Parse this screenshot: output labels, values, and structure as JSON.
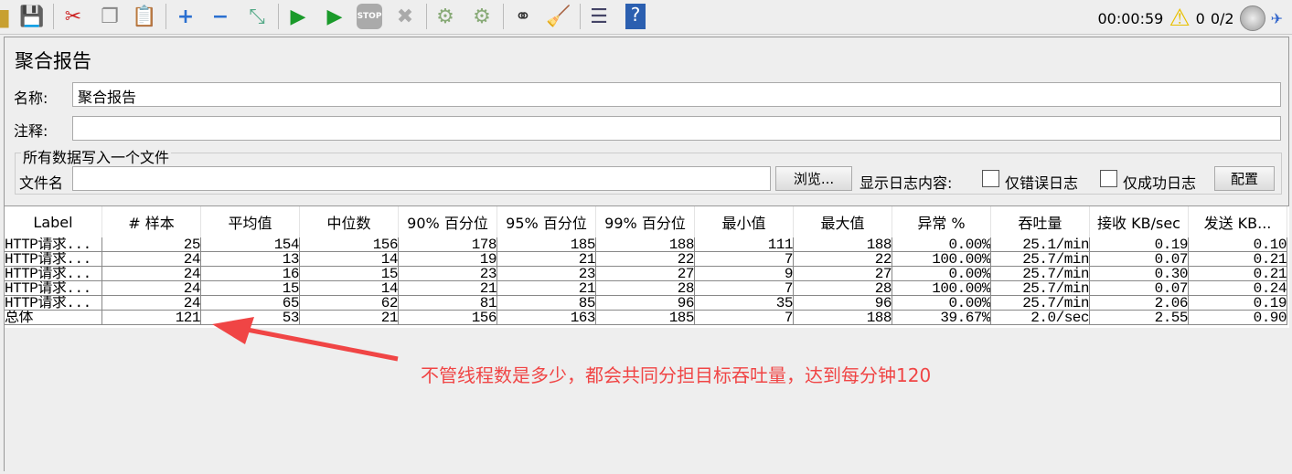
{
  "toolbar": {
    "icons": [
      "open-icon",
      "save-icon",
      "cut-icon",
      "copy-icon",
      "paste-icon",
      "expand-icon",
      "collapse-icon",
      "toggle-icon",
      "start-icon",
      "start-no-pause-icon",
      "stop-icon",
      "shutdown-icon",
      "clear-icon",
      "clear-all-icon",
      "search-icon",
      "reset-search-icon",
      "function-helper-icon",
      "help-icon"
    ],
    "stop_label": "STOP",
    "help_label": "?",
    "timer": "00:00:59",
    "warning_count": "0",
    "threads": "0/2"
  },
  "panel": {
    "title": "聚合报告",
    "name_label": "名称:",
    "name_value": "聚合报告",
    "comment_label": "注释:",
    "comment_value": "",
    "file_group_title": "所有数据写入一个文件",
    "filename_label": "文件名",
    "filename_value": "",
    "browse_button": "浏览...",
    "log_content_label": "显示日志内容:",
    "errors_only_label": "仅错误日志",
    "success_only_label": "仅成功日志",
    "configure_button": "配置"
  },
  "table": {
    "headers": [
      "Label",
      "# 样本",
      "平均值",
      "中位数",
      "90% 百分位",
      "95% 百分位",
      "99% 百分位",
      "最小值",
      "最大值",
      "异常 %",
      "吞吐量",
      "接收 KB/sec",
      "发送 KB..."
    ],
    "rows": [
      [
        "HTTP请求...",
        "25",
        "154",
        "156",
        "178",
        "185",
        "188",
        "111",
        "188",
        "0.00%",
        "25.1/min",
        "0.19",
        "0.10"
      ],
      [
        "HTTP请求...",
        "24",
        "13",
        "14",
        "19",
        "21",
        "22",
        "7",
        "22",
        "100.00%",
        "25.7/min",
        "0.07",
        "0.21"
      ],
      [
        "HTTP请求...",
        "24",
        "16",
        "15",
        "23",
        "23",
        "27",
        "9",
        "27",
        "0.00%",
        "25.7/min",
        "0.30",
        "0.21"
      ],
      [
        "HTTP请求...",
        "24",
        "15",
        "14",
        "21",
        "21",
        "28",
        "7",
        "28",
        "100.00%",
        "25.7/min",
        "0.07",
        "0.24"
      ],
      [
        "HTTP请求...",
        "24",
        "65",
        "62",
        "81",
        "85",
        "96",
        "35",
        "96",
        "0.00%",
        "25.7/min",
        "2.06",
        "0.19"
      ],
      [
        "总体",
        "121",
        "53",
        "21",
        "156",
        "163",
        "185",
        "7",
        "188",
        "39.67%",
        "2.0/sec",
        "2.55",
        "0.90"
      ]
    ]
  },
  "annotation": {
    "text": "不管线程数是多少，都会共同分担目标吞吐量，达到每分钟120",
    "color": "#f04545"
  }
}
